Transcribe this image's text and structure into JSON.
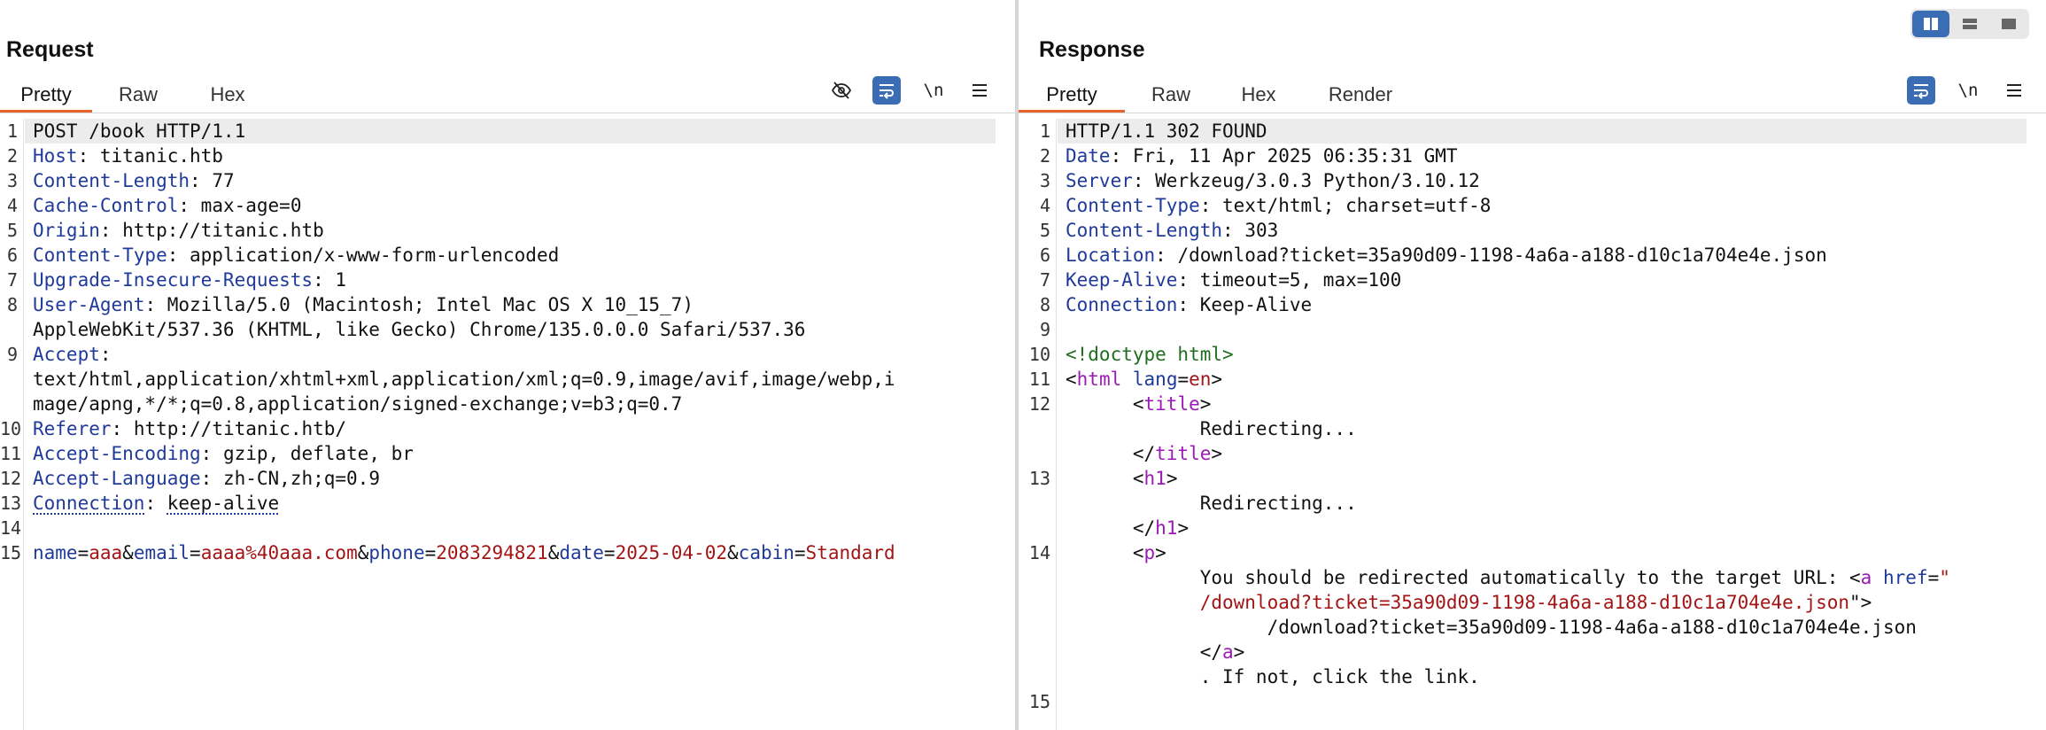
{
  "request": {
    "title": "Request",
    "tabs": [
      "Pretty",
      "Raw",
      "Hex"
    ],
    "active_tab": "Pretty",
    "tools": [
      "eye-off-icon",
      "wrap-icon",
      "\\n",
      "menu-icon"
    ],
    "lines": [
      {
        "num": "1",
        "text": "POST /book HTTP/1.1"
      },
      {
        "num": "2",
        "key": "Host",
        "value": "titanic.htb"
      },
      {
        "num": "3",
        "key": "Content-Length",
        "value": "77"
      },
      {
        "num": "4",
        "key": "Cache-Control",
        "value": "max-age=0"
      },
      {
        "num": "5",
        "key": "Origin",
        "value": "http://titanic.htb"
      },
      {
        "num": "6",
        "key": "Content-Type",
        "value": "application/x-www-form-urlencoded"
      },
      {
        "num": "7",
        "key": "Upgrade-Insecure-Requests",
        "value": "1"
      },
      {
        "num": "8",
        "key": "User-Agent",
        "value": "Mozilla/5.0 (Macintosh; Intel Mac OS X 10_15_7)"
      },
      {
        "num": "",
        "text": "AppleWebKit/537.36 (KHTML, like Gecko) Chrome/135.0.0.0 Safari/537.36"
      },
      {
        "num": "9",
        "key": "Accept",
        "value": ""
      },
      {
        "num": "",
        "text": "text/html,application/xhtml+xml,application/xml;q=0.9,image/avif,image/webp,i"
      },
      {
        "num": "",
        "text": "mage/apng,*/*;q=0.8,application/signed-exchange;v=b3;q=0.7"
      },
      {
        "num": "10",
        "key": "Referer",
        "value": "http://titanic.htb/"
      },
      {
        "num": "11",
        "key": "Accept-Encoding",
        "value": "gzip, deflate, br"
      },
      {
        "num": "12",
        "key": "Accept-Language",
        "value": "zh-CN,zh;q=0.9"
      },
      {
        "num": "13",
        "key": "Connection",
        "value": "keep-alive"
      },
      {
        "num": "14",
        "text": ""
      },
      {
        "num": "15",
        "params": [
          {
            "k": "name",
            "v": "aaa"
          },
          {
            "k": "email",
            "v": "aaaa%40aaa.com"
          },
          {
            "k": "phone",
            "v": "2083294821"
          },
          {
            "k": "date",
            "v": "2025-04-02"
          },
          {
            "k": "cabin",
            "v": "Standard"
          }
        ]
      }
    ]
  },
  "response": {
    "title": "Response",
    "tabs": [
      "Pretty",
      "Raw",
      "Hex",
      "Render"
    ],
    "active_tab": "Pretty",
    "tools": [
      "wrap-icon",
      "\\n",
      "menu-icon"
    ],
    "lines": [
      {
        "num": "1",
        "text": "HTTP/1.1 302 FOUND"
      },
      {
        "num": "2",
        "key": "Date",
        "value": "Fri, 11 Apr 2025 06:35:31 GMT"
      },
      {
        "num": "3",
        "key": "Server",
        "value": "Werkzeug/3.0.3 Python/3.10.12"
      },
      {
        "num": "4",
        "key": "Content-Type",
        "value": "text/html; charset=utf-8"
      },
      {
        "num": "5",
        "key": "Content-Length",
        "value": "303"
      },
      {
        "num": "6",
        "key": "Location",
        "value": "/download?ticket=35a90d09-1198-4a6a-a188-d10c1a704e4e.json"
      },
      {
        "num": "7",
        "key": "Keep-Alive",
        "value": "timeout=5, max=100"
      },
      {
        "num": "8",
        "key": "Connection",
        "value": "Keep-Alive"
      },
      {
        "num": "9",
        "text": ""
      },
      {
        "num": "10",
        "html": [
          {
            "c": "doctype",
            "t": "<!doctype html>"
          }
        ]
      },
      {
        "num": "11",
        "html": [
          {
            "c": "punct",
            "t": "<"
          },
          {
            "c": "tagname",
            "t": "html"
          },
          {
            "c": "punct",
            "t": " "
          },
          {
            "c": "attr",
            "t": "lang"
          },
          {
            "c": "punct",
            "t": "="
          },
          {
            "c": "attrval",
            "t": "en"
          },
          {
            "c": "punct",
            "t": ">"
          }
        ]
      },
      {
        "num": "12",
        "html": [
          {
            "c": "punct",
            "t": "      <"
          },
          {
            "c": "tagname",
            "t": "title"
          },
          {
            "c": "punct",
            "t": ">"
          }
        ]
      },
      {
        "num": "",
        "text": "            Redirecting..."
      },
      {
        "num": "",
        "html": [
          {
            "c": "punct",
            "t": "      </"
          },
          {
            "c": "tagname",
            "t": "title"
          },
          {
            "c": "punct",
            "t": ">"
          }
        ]
      },
      {
        "num": "13",
        "html": [
          {
            "c": "punct",
            "t": "      <"
          },
          {
            "c": "tagname",
            "t": "h1"
          },
          {
            "c": "punct",
            "t": ">"
          }
        ]
      },
      {
        "num": "",
        "text": "            Redirecting..."
      },
      {
        "num": "",
        "html": [
          {
            "c": "punct",
            "t": "      </"
          },
          {
            "c": "tagname",
            "t": "h1"
          },
          {
            "c": "punct",
            "t": ">"
          }
        ]
      },
      {
        "num": "14",
        "html": [
          {
            "c": "punct",
            "t": "      <"
          },
          {
            "c": "tagname",
            "t": "p"
          },
          {
            "c": "punct",
            "t": ">"
          }
        ]
      },
      {
        "num": "",
        "html": [
          {
            "c": "punct",
            "t": "            You should be redirected automatically to the target URL: <"
          },
          {
            "c": "tagname",
            "t": "a"
          },
          {
            "c": "punct",
            "t": " "
          },
          {
            "c": "attr",
            "t": "href"
          },
          {
            "c": "punct",
            "t": "="
          },
          {
            "c": "attrval",
            "t": "\""
          }
        ]
      },
      {
        "num": "",
        "html": [
          {
            "c": "attrval",
            "t": "            /download?ticket=35a90d09-1198-4a6a-a188-d10c1a704e4e.json"
          },
          {
            "c": "punct",
            "t": "\">"
          }
        ]
      },
      {
        "num": "",
        "text": "                  /download?ticket=35a90d09-1198-4a6a-a188-d10c1a704e4e.json"
      },
      {
        "num": "",
        "html": [
          {
            "c": "punct",
            "t": "            </"
          },
          {
            "c": "tagname",
            "t": "a"
          },
          {
            "c": "punct",
            "t": ">"
          }
        ]
      },
      {
        "num": "",
        "text": "            . If not, click the link."
      },
      {
        "num": "15",
        "text": ""
      }
    ]
  }
}
